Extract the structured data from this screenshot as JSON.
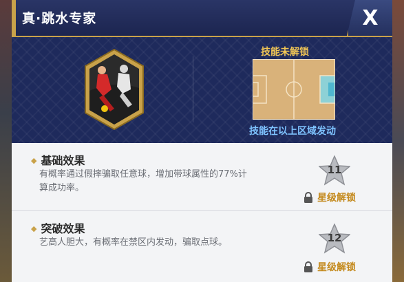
{
  "title": "真·跳水专家",
  "close_label": "X",
  "skill": {
    "locked_label": "技能未解锁",
    "area_label": "技能在以上区域发动"
  },
  "effects": [
    {
      "title": "基础效果",
      "desc_line1": "有概率通过假摔骗取任意球，增加带球属性的77%计",
      "desc_line2": "算成功率。",
      "star_level": "11",
      "unlock_label": "星级解锁"
    },
    {
      "title": "突破效果",
      "desc_line1": "艺高人胆大，有概率在禁区内发动，骗取点球。",
      "desc_line2": "",
      "star_level": "12",
      "unlock_label": "星级解锁"
    }
  ],
  "colors": {
    "header_bg": "#1c2550",
    "gold": "#c9a24a",
    "locked_text": "#f0c555",
    "area_text": "#7ec3ff",
    "unlock_text": "#c48a1e",
    "pitch_highlight": "#7fd6e6"
  }
}
